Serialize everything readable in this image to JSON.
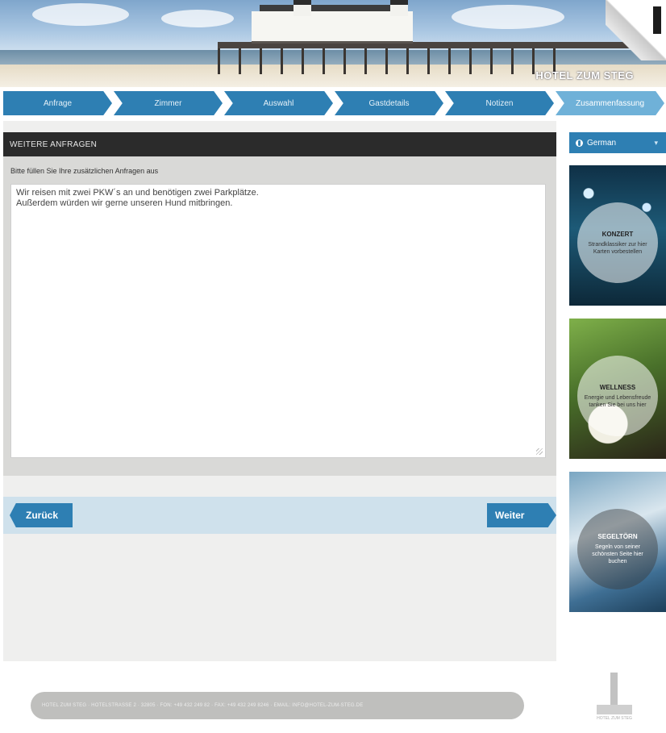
{
  "header": {
    "logo_text": "HOTEL ZUM STEG"
  },
  "steps": [
    {
      "label": "Anfrage"
    },
    {
      "label": "Zimmer"
    },
    {
      "label": "Auswahl"
    },
    {
      "label": "Gastdetails"
    },
    {
      "label": "Notizen"
    },
    {
      "label": "Zusammenfassung",
      "active": true
    }
  ],
  "panel": {
    "title": "WEITERE ANFRAGEN",
    "instruction": "Bitte füllen Sie Ihre zusätzlichen Anfragen aus",
    "text_line1": "Wir reisen mit zwei PKW´s an und benötigen zwei Parkplätze.",
    "text_line2": "Außerdem würden wir gerne unseren Hund mitbringen."
  },
  "buttons": {
    "back_label": "Zurück",
    "next_label": "Weiter"
  },
  "language": {
    "selected": "German"
  },
  "promos": [
    {
      "title": "KONZERT",
      "text": "Strandklassiker zur hier Karten vorbestellen"
    },
    {
      "title": "WELLNESS",
      "text": "Energie und Lebensfreude tanken Sie bei uns hier"
    },
    {
      "title": "SEGELTÖRN",
      "text": "Segeln von seiner schönsten Seite hier buchen"
    }
  ],
  "footer": {
    "contact": "HOTEL ZUM STEG · HOTELSTRASSE 2 · 32805 · FON: +49 432 249 82 · FAX: +49 432 249 8246 · EMAIL: INFO@HOTEL-ZUM-STEG.DE",
    "logo_caption": "HOTEL ZUM STEG"
  },
  "colors": {
    "accent": "#2e7fb3",
    "accent_light": "#6fb1d8",
    "panel_head": "#2b2b2b"
  }
}
